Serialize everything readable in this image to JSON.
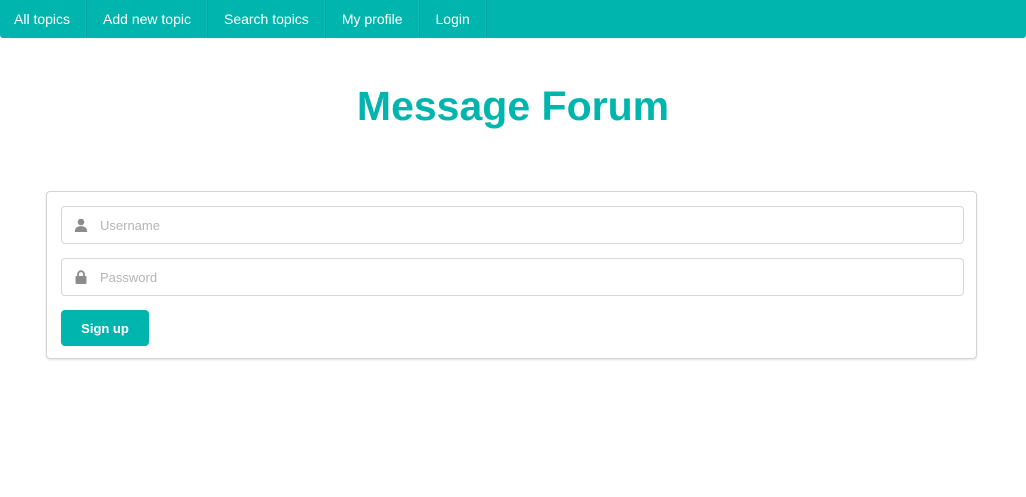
{
  "nav": {
    "items": [
      {
        "label": "All topics"
      },
      {
        "label": "Add new topic"
      },
      {
        "label": "Search topics"
      },
      {
        "label": "My profile"
      },
      {
        "label": "Login"
      }
    ]
  },
  "page": {
    "title": "Message Forum"
  },
  "form": {
    "username": {
      "placeholder": "Username",
      "value": "",
      "icon": "user-icon"
    },
    "password": {
      "placeholder": "Password",
      "value": "",
      "icon": "lock-icon"
    },
    "submit_label": "Sign up"
  },
  "colors": {
    "accent": "#00b5ad",
    "border": "#d4d4d5",
    "placeholder": "#b5b5b5",
    "icon": "#8c8c8c"
  }
}
